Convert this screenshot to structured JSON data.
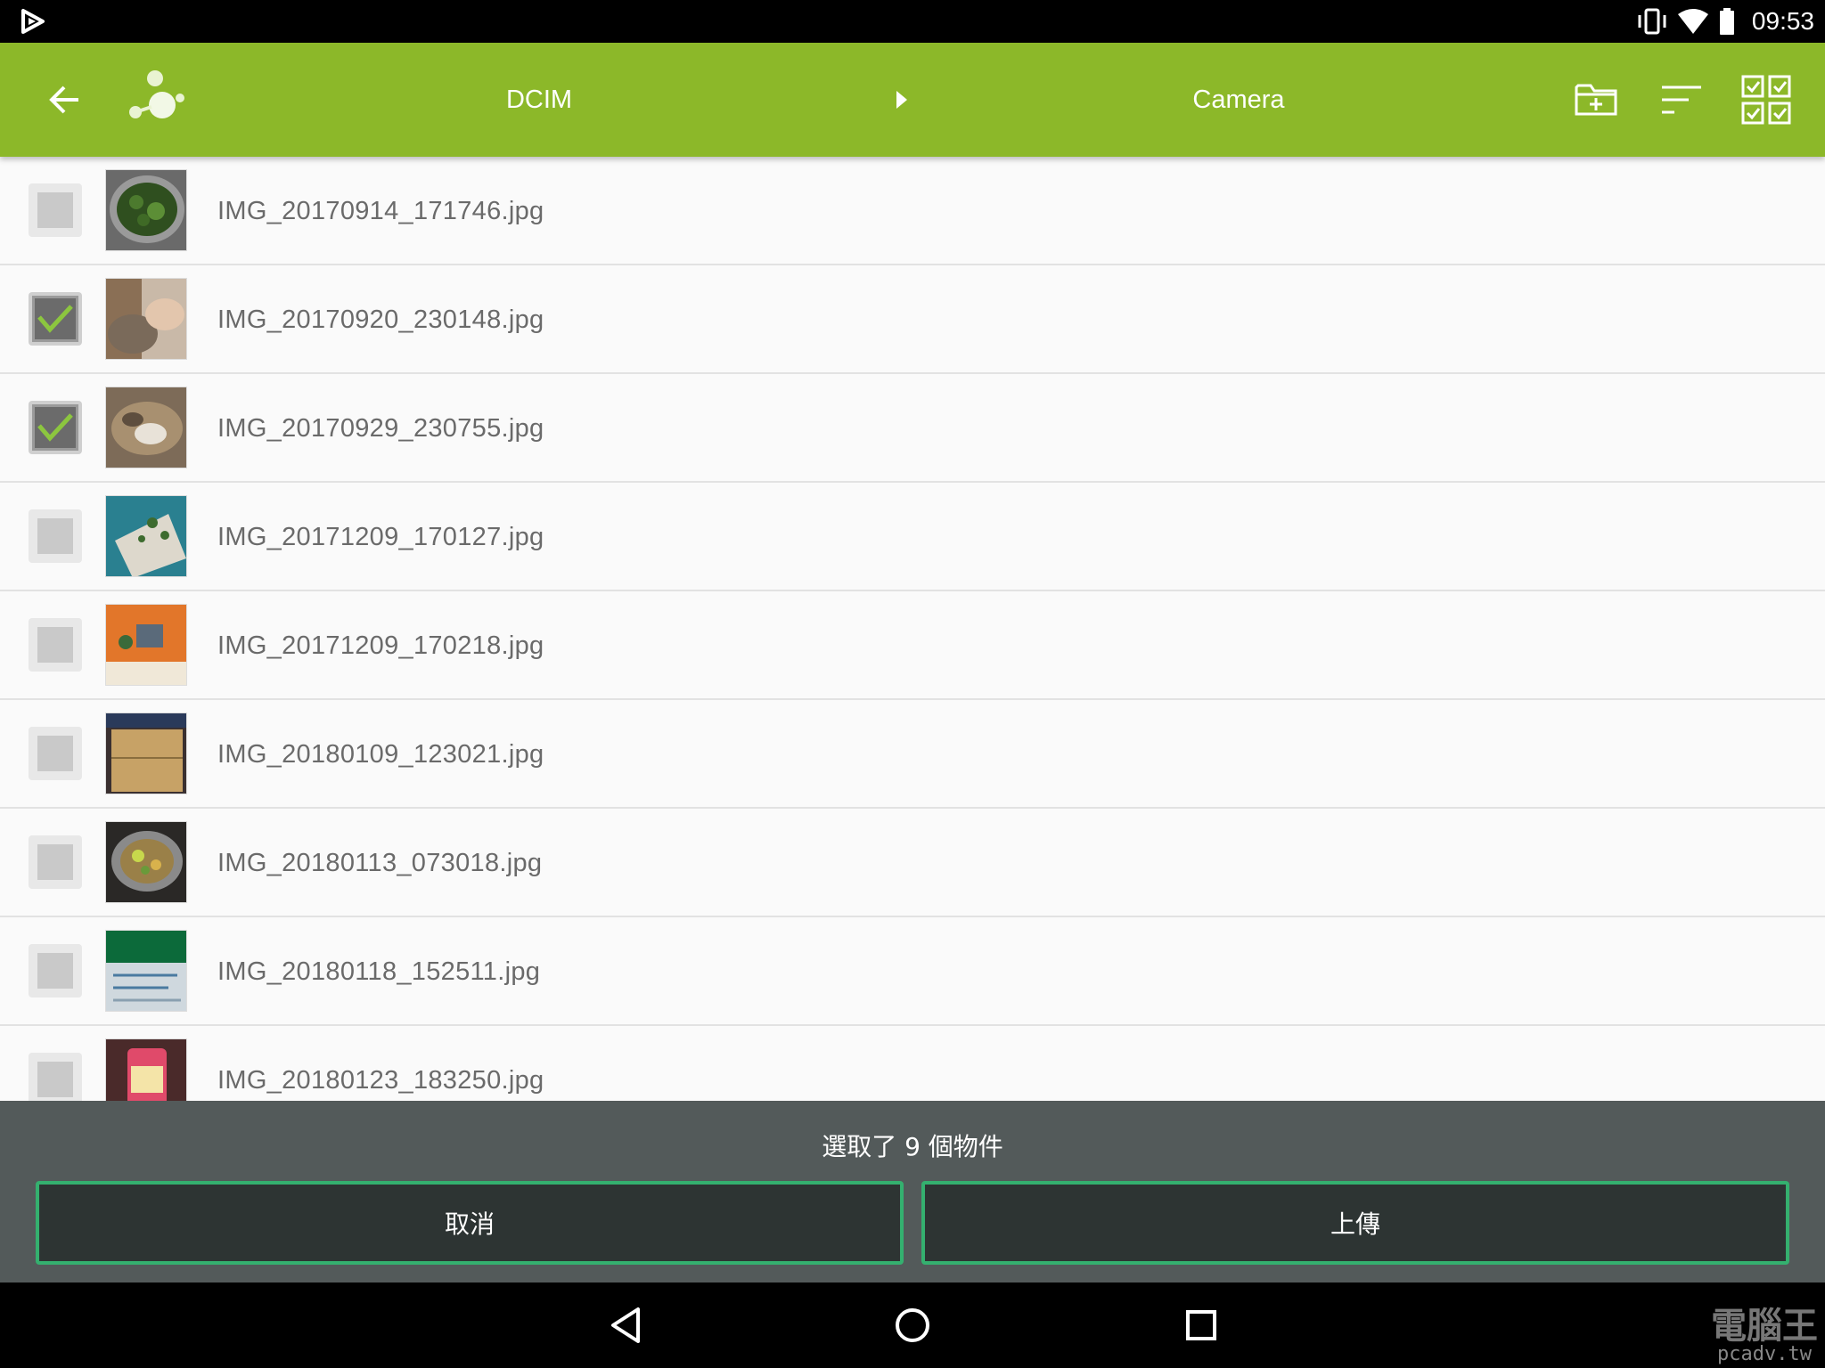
{
  "status_bar": {
    "time": "09:53",
    "icons": [
      "app-logo-icon",
      "vibrate-icon",
      "wifi-icon",
      "battery-icon"
    ]
  },
  "toolbar": {
    "breadcrumb": [
      "DCIM",
      "Camera"
    ],
    "icons": [
      "back-arrow-icon",
      "app-logo-icon",
      "breadcrumb-arrow-icon",
      "new-folder-icon",
      "sort-icon",
      "select-all-icon"
    ],
    "color": "#8cb829"
  },
  "files": [
    {
      "name": "IMG_20170914_171746.jpg",
      "checked": false
    },
    {
      "name": "IMG_20170920_230148.jpg",
      "checked": true
    },
    {
      "name": "IMG_20170929_230755.jpg",
      "checked": true
    },
    {
      "name": "IMG_20171209_170127.jpg",
      "checked": false
    },
    {
      "name": "IMG_20171209_170218.jpg",
      "checked": false
    },
    {
      "name": "IMG_20180109_123021.jpg",
      "checked": false
    },
    {
      "name": "IMG_20180113_073018.jpg",
      "checked": false
    },
    {
      "name": "IMG_20180118_152511.jpg",
      "checked": false
    },
    {
      "name": "IMG_20180123_183250.jpg",
      "checked": false
    }
  ],
  "bottom": {
    "selection_text": "選取了 9 個物件",
    "cancel_label": "取消",
    "upload_label": "上傳",
    "button_border": "#34b06f"
  },
  "nav": {
    "icons": [
      "nav-back-icon",
      "nav-home-icon",
      "nav-recent-icon"
    ]
  },
  "watermark": {
    "main": "電腦王",
    "sub": "pcadv.tw"
  }
}
